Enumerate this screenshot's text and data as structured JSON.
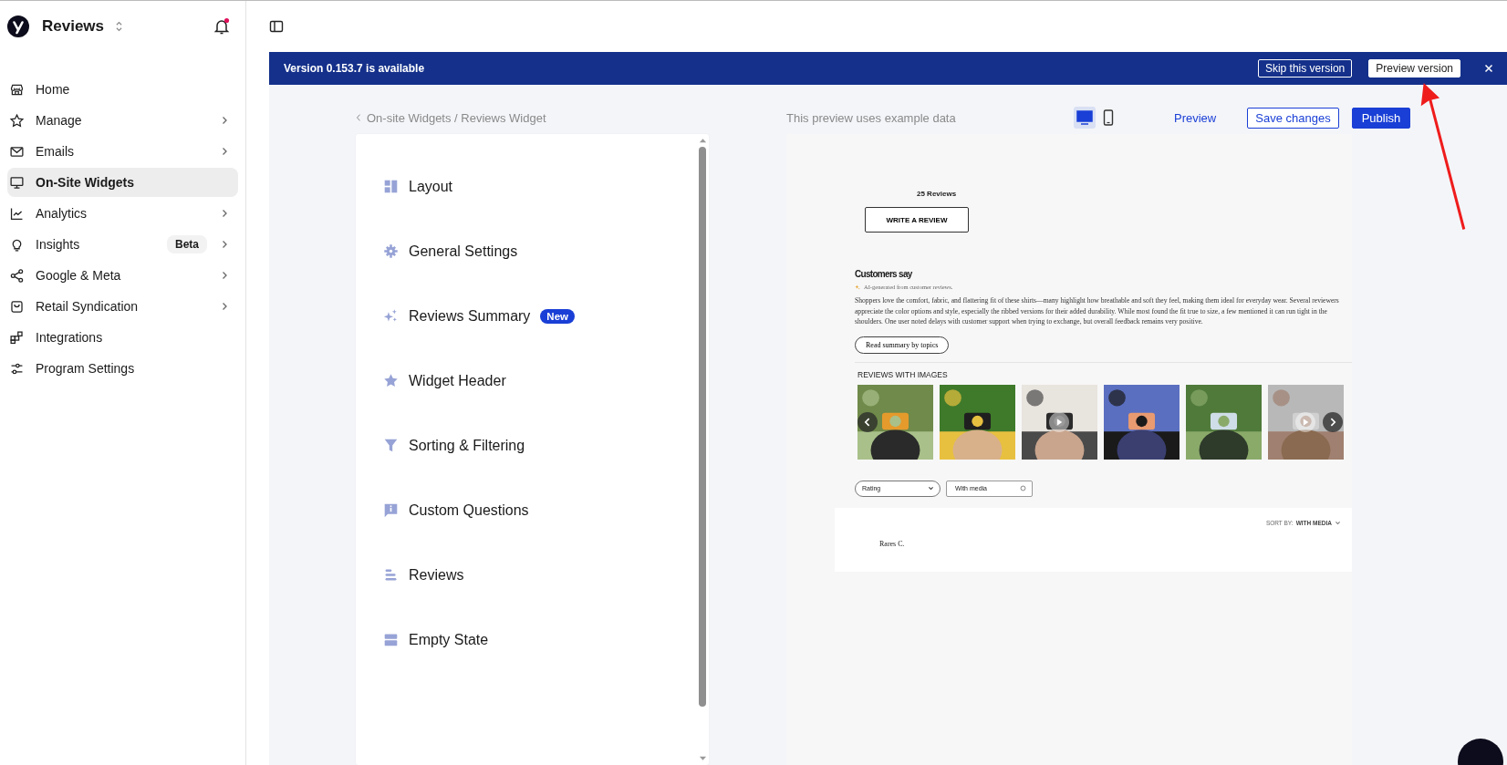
{
  "app": {
    "name": "Reviews"
  },
  "notifications": {
    "unread": true
  },
  "nav": [
    {
      "label": "Home",
      "selected": false,
      "has_submenu": false
    },
    {
      "label": "Manage",
      "selected": false,
      "has_submenu": true
    },
    {
      "label": "Emails",
      "selected": false,
      "has_submenu": true
    },
    {
      "label": "On-Site Widgets",
      "selected": true,
      "has_submenu": false
    },
    {
      "label": "Analytics",
      "selected": false,
      "has_submenu": true
    },
    {
      "label": "Insights",
      "selected": false,
      "has_submenu": true,
      "badge": "Beta"
    },
    {
      "label": "Google & Meta",
      "selected": false,
      "has_submenu": true
    },
    {
      "label": "Retail Syndication",
      "selected": false,
      "has_submenu": true
    },
    {
      "label": "Integrations",
      "selected": false,
      "has_submenu": false
    },
    {
      "label": "Program Settings",
      "selected": false,
      "has_submenu": false
    }
  ],
  "banner": {
    "message": "Version 0.153.7 is available",
    "buttons": [
      "Skip this version",
      "Preview version"
    ]
  },
  "toolbar": {
    "breadcrumb": "On-site Widgets / Reviews Widget",
    "note": "This preview uses example data",
    "devices": [
      {
        "selected": true
      },
      {
        "selected": false
      }
    ],
    "preview_link": "Preview",
    "save_button": "Save changes",
    "publish_button": "Publish"
  },
  "settings_menu": [
    {
      "label": "Layout"
    },
    {
      "label": "General Settings"
    },
    {
      "label": "Reviews Summary",
      "badge": "New"
    },
    {
      "label": "Widget Header"
    },
    {
      "label": "Sorting & Filtering"
    },
    {
      "label": "Custom Questions"
    },
    {
      "label": "Reviews"
    },
    {
      "label": "Empty State"
    }
  ],
  "widget_preview": {
    "review_count": "25 Reviews",
    "write_button": "WRITE A REVIEW",
    "summary": {
      "title": "Customers say",
      "ai_note": "AI-generated from customer reviews.",
      "text": "Shoppers love the comfort, fabric, and flattering fit of these shirts—many highlight how breathable and soft they feel, making them ideal for everyday wear. Several reviewers appreciate the color options and style, especially the ribbed versions for their added durability. While most found the fit true to size, a few mentioned it can run tight in the shoulders. One user noted delays with customer support when trying to exchange, but overall feedback remains very positive.",
      "topics_button": "Read summary by topics"
    },
    "media": {
      "title": "REVIEWS WITH IMAGES",
      "photos": [
        {
          "kind": "picture",
          "video": false
        },
        {
          "kind": "picture",
          "video": false
        },
        {
          "kind": "picture",
          "video": true
        },
        {
          "kind": "picture",
          "video": false
        },
        {
          "kind": "picture",
          "video": false
        },
        {
          "kind": "picture",
          "video": true
        }
      ]
    },
    "filters": {
      "rating": "Rating",
      "with_media": "With media"
    },
    "sort": {
      "label": "SORT BY:",
      "value": "WITH MEDIA"
    },
    "reviewer": "Rares C."
  }
}
